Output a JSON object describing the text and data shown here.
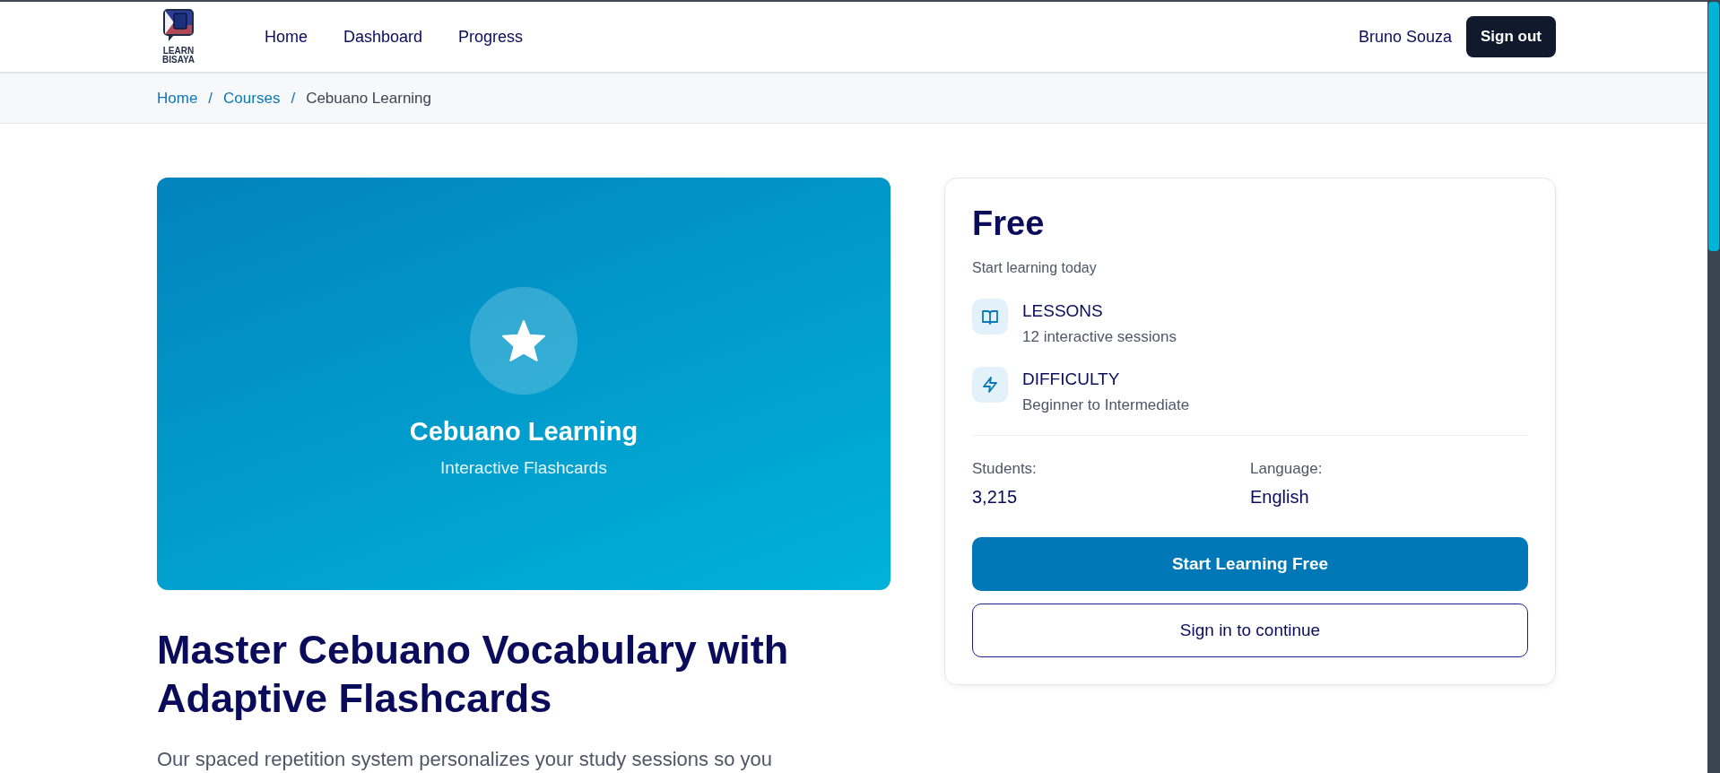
{
  "navbar": {
    "logo_text": [
      "LEARN",
      "BISAYA"
    ],
    "links": [
      {
        "label": "Home"
      },
      {
        "label": "Dashboard"
      },
      {
        "label": "Progress"
      }
    ],
    "user": "Bruno Souza",
    "sign_out": "Sign out"
  },
  "breadcrumb_separator": "/",
  "breadcrumb": [
    {
      "label": "Home",
      "current": false
    },
    {
      "label": "Courses",
      "current": false
    },
    {
      "label": "Cebuano Learning",
      "current": true
    }
  ],
  "hero": {
    "title": "Cebuano Learning",
    "subtitle": "Interactive Flashcards"
  },
  "heading": "Master Cebuano Vocabulary with Adaptive Flashcards",
  "intro": "Our spaced repetition system personalizes your study sessions so you",
  "card": {
    "price": "Free",
    "tagline": "Start learning today",
    "features": [
      {
        "kind": "book",
        "label": "LESSONS",
        "detail": "12 interactive sessions"
      },
      {
        "kind": "bolt",
        "label": "DIFFICULTY",
        "detail": "Beginner to Intermediate"
      }
    ],
    "stats": [
      {
        "label": "Students:",
        "value": "3,215"
      },
      {
        "label": "Language:",
        "value": "English"
      }
    ],
    "buttons": [
      {
        "kind": "primary",
        "label": "Start Learning Free"
      },
      {
        "kind": "outline",
        "label": "Sign in to continue"
      }
    ]
  }
}
